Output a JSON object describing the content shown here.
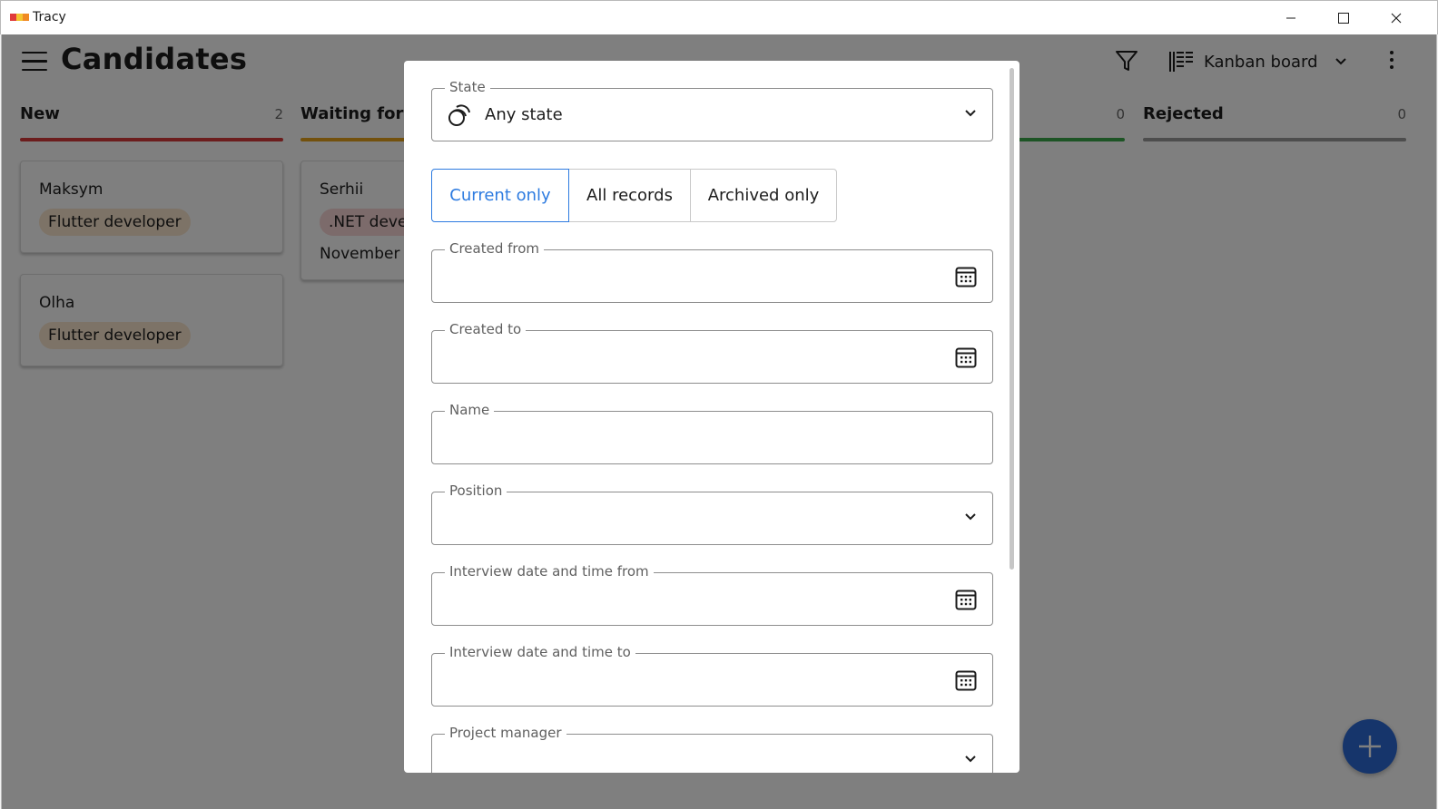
{
  "window": {
    "title": "Tracy",
    "minimize_icon": "minimize-icon",
    "maximize_icon": "maximize-icon",
    "close_icon": "close-icon"
  },
  "appbar": {
    "title": "Candidates",
    "menu_icon": "hamburger-menu-icon",
    "filter_icon": "filter-icon",
    "view_icon": "kanban-icon",
    "view_label": "Kanban board",
    "more_icon": "more-vertical-icon"
  },
  "board": {
    "columns": [
      {
        "name": "New",
        "count": "2",
        "color": "#d83a3a"
      },
      {
        "name": "Waiting for interview",
        "count": "",
        "color": "#e6a21a"
      },
      {
        "name": "",
        "count": "0",
        "color": "#3ba84a"
      },
      {
        "name": "Rejected",
        "count": "0",
        "color": "#9a9a9a"
      }
    ],
    "cards": [
      {
        "name": "Maksym",
        "position": "Flutter developer",
        "chip_color": "#fbe7cf"
      },
      {
        "name": "Olha",
        "position": "Flutter developer",
        "chip_color": "#fbe7cf"
      },
      {
        "name": "Serhii",
        "position": ".NET developer",
        "date": "November",
        "chip_color": "#f9d6d6"
      }
    ],
    "fab_icon": "plus-icon",
    "fab_color": "#2d6bd6"
  },
  "filter_dialog": {
    "state": {
      "label": "State",
      "value": "Any state",
      "icon": "states-icon"
    },
    "record_filter": {
      "options": [
        "Current only",
        "All records",
        "Archived only"
      ],
      "selected": "Current only"
    },
    "created_from": {
      "label": "Created from",
      "value": ""
    },
    "created_to": {
      "label": "Created to",
      "value": ""
    },
    "name": {
      "label": "Name",
      "value": ""
    },
    "position": {
      "label": "Position",
      "value": ""
    },
    "interview_from": {
      "label": "Interview date and time from",
      "value": ""
    },
    "interview_to": {
      "label": "Interview date and time to",
      "value": ""
    },
    "project_manager": {
      "label": "Project manager",
      "value": ""
    }
  }
}
